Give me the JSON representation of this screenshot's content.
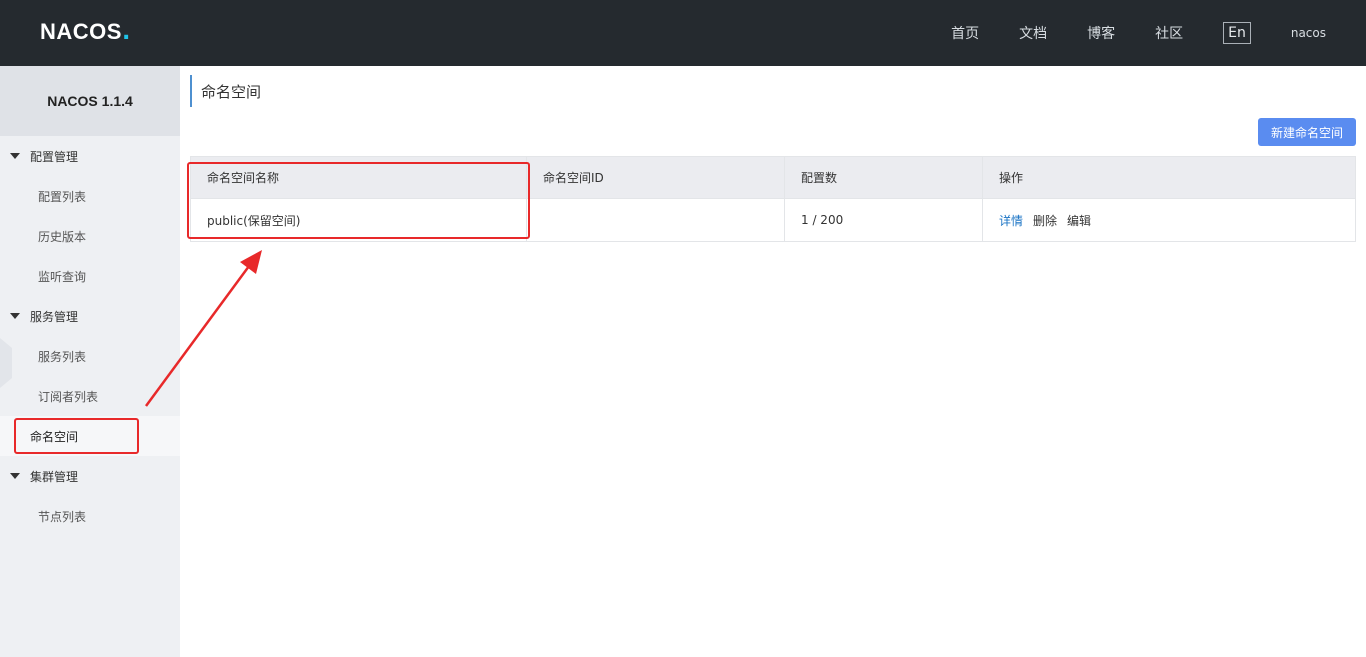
{
  "header": {
    "logo_text": "NACOS",
    "logo_dot": ".",
    "nav": [
      "首页",
      "文档",
      "博客",
      "社区"
    ],
    "lang": "En",
    "user": "nacos"
  },
  "sidebar": {
    "version": "NACOS 1.1.4",
    "groups": [
      {
        "label": "配置管理",
        "items": [
          "配置列表",
          "历史版本",
          "监听查询"
        ]
      },
      {
        "label": "服务管理",
        "items": [
          "服务列表",
          "订阅者列表"
        ]
      },
      {
        "active_item": "命名空间"
      },
      {
        "label": "集群管理",
        "items": [
          "节点列表"
        ]
      }
    ]
  },
  "main": {
    "title": "命名空间",
    "new_button": "新建命名空间",
    "table": {
      "headers": [
        "命名空间名称",
        "命名空间ID",
        "配置数",
        "操作"
      ],
      "rows": [
        {
          "name": "public(保留空间)",
          "id": "",
          "count": "1 / 200",
          "ops": [
            "详情",
            "删除",
            "编辑"
          ]
        }
      ]
    }
  },
  "colors": {
    "topbar": "#252a2f",
    "accent": "#5a8cf0",
    "link": "#1a73c4",
    "annotation": "#e8292a"
  }
}
